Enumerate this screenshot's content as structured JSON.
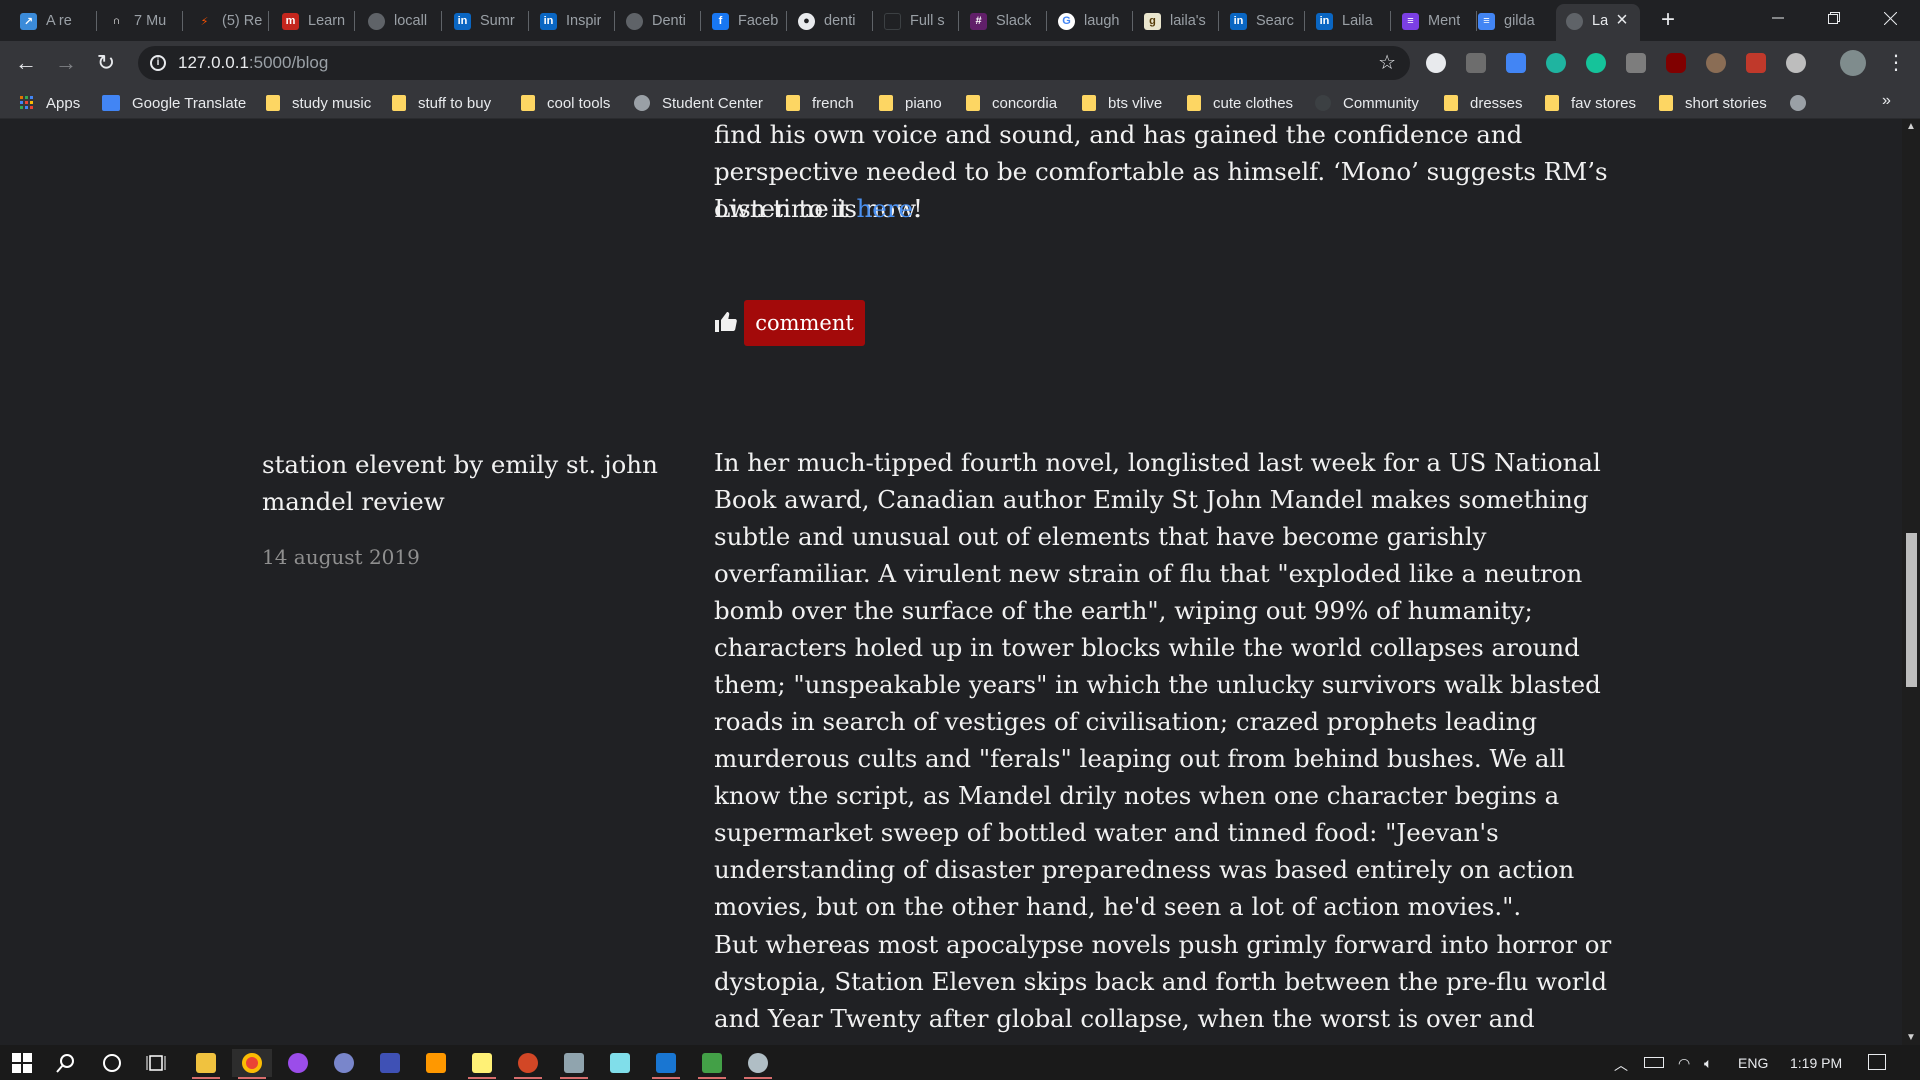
{
  "browser": {
    "tabs": [
      {
        "label": "A re",
        "icon": "box-arrow-icon",
        "color": "#3b8bd9"
      },
      {
        "label": "7 Mu",
        "icon": "headphones-icon",
        "color": "#202124"
      },
      {
        "label": "(5) Re",
        "icon": "strava-icon",
        "color": "#202124"
      },
      {
        "label": "Learn",
        "icon": "m-logo-icon",
        "color": "#c4261d"
      },
      {
        "label": "locall",
        "icon": "globe-icon",
        "color": "#5f6368"
      },
      {
        "label": "Sumr",
        "icon": "linkedin-icon",
        "color": "#0a66c2"
      },
      {
        "label": "Inspir",
        "icon": "linkedin-icon",
        "color": "#0a66c2"
      },
      {
        "label": "Denti",
        "icon": "globe-icon",
        "color": "#5f6368"
      },
      {
        "label": "Faceb",
        "icon": "facebook-icon",
        "color": "#1877f2"
      },
      {
        "label": "denti",
        "icon": "github-icon",
        "color": "#202124"
      },
      {
        "label": "Full s",
        "icon": "page-icon",
        "color": "#202124"
      },
      {
        "label": "Slack",
        "icon": "slack-icon",
        "color": "#611f69"
      },
      {
        "label": "laugh",
        "icon": "google-icon",
        "color": "#ffffff"
      },
      {
        "label": "laila's",
        "icon": "goodreads-icon",
        "color": "#e9e5cd"
      },
      {
        "label": "Searc",
        "icon": "linkedin-icon",
        "color": "#0a66c2"
      },
      {
        "label": "Laila",
        "icon": "linkedin-icon",
        "color": "#0a66c2"
      },
      {
        "label": "Ment",
        "icon": "list-icon",
        "color": "#7b3fe4"
      },
      {
        "label": "gilda",
        "icon": "docs-icon",
        "color": "#4285f4"
      },
      {
        "label": "La",
        "icon": "globe-icon",
        "color": "#5f6368",
        "active": true
      }
    ],
    "url_host": "127.0.0.1",
    "url_path": ":5000/blog",
    "bookmarks": [
      {
        "label": "Apps",
        "icon": "apps-grid-icon"
      },
      {
        "label": "Google Translate",
        "icon": "translate-icon"
      },
      {
        "label": "study music",
        "icon": "folder-icon"
      },
      {
        "label": "stuff to buy",
        "icon": "folder-icon"
      },
      {
        "label": "cool tools",
        "icon": "folder-icon"
      },
      {
        "label": "Student Center",
        "icon": "globe-icon"
      },
      {
        "label": "french",
        "icon": "folder-icon"
      },
      {
        "label": "piano",
        "icon": "folder-icon"
      },
      {
        "label": "concordia",
        "icon": "folder-icon"
      },
      {
        "label": "bts vlive",
        "icon": "folder-icon"
      },
      {
        "label": "cute clothes",
        "icon": "folder-icon"
      },
      {
        "label": "Community",
        "icon": "community-icon"
      },
      {
        "label": "dresses",
        "icon": "folder-icon"
      },
      {
        "label": "fav stores",
        "icon": "folder-icon"
      },
      {
        "label": "short stories",
        "icon": "folder-icon"
      }
    ]
  },
  "blog": {
    "prev_post_end": "find his own voice and sound, and has gained the confidence and perspective needed to be comfortable as himself. ‘Mono’ suggests RM’s own time is now.",
    "listen_prefix": "Listen to it ",
    "listen_link": "here",
    "listen_suffix": "!",
    "comment_label": "comment",
    "post": {
      "title": "station elevent by emily st. john mandel review",
      "date": "14 august 2019",
      "para1": "In her much-tipped fourth novel, longlisted last week for a US National Book award, Canadian author Emily St John Mandel makes something subtle and unusual out of elements that have become garishly overfamiliar. A virulent new strain of flu that \"exploded like a neutron bomb over the surface of the earth\", wiping out 99% of humanity; characters holed up in tower blocks while the world collapses around them; \"unspeakable years\" in which the unlucky survivors walk blasted roads in search of vestiges of civilisation; crazed prophets leading murderous cults and \"ferals\" leaping out from behind bushes. We all know the script, as Mandel drily notes when one character begins a supermarket sweep of bottled water and tinned food: \"Jeevan's understanding of disaster preparedness was based entirely on action movies, but on the other hand, he'd seen a lot of action movies.\".",
      "para2": "But whereas most apocalypse novels push grimly forward into horror or dystopia, Station Eleven skips back and forth between the pre-flu world and Year Twenty after global collapse, when the worst is over and survivors have"
    }
  },
  "taskbar": {
    "language": "ENG",
    "time": "1:19 PM"
  }
}
